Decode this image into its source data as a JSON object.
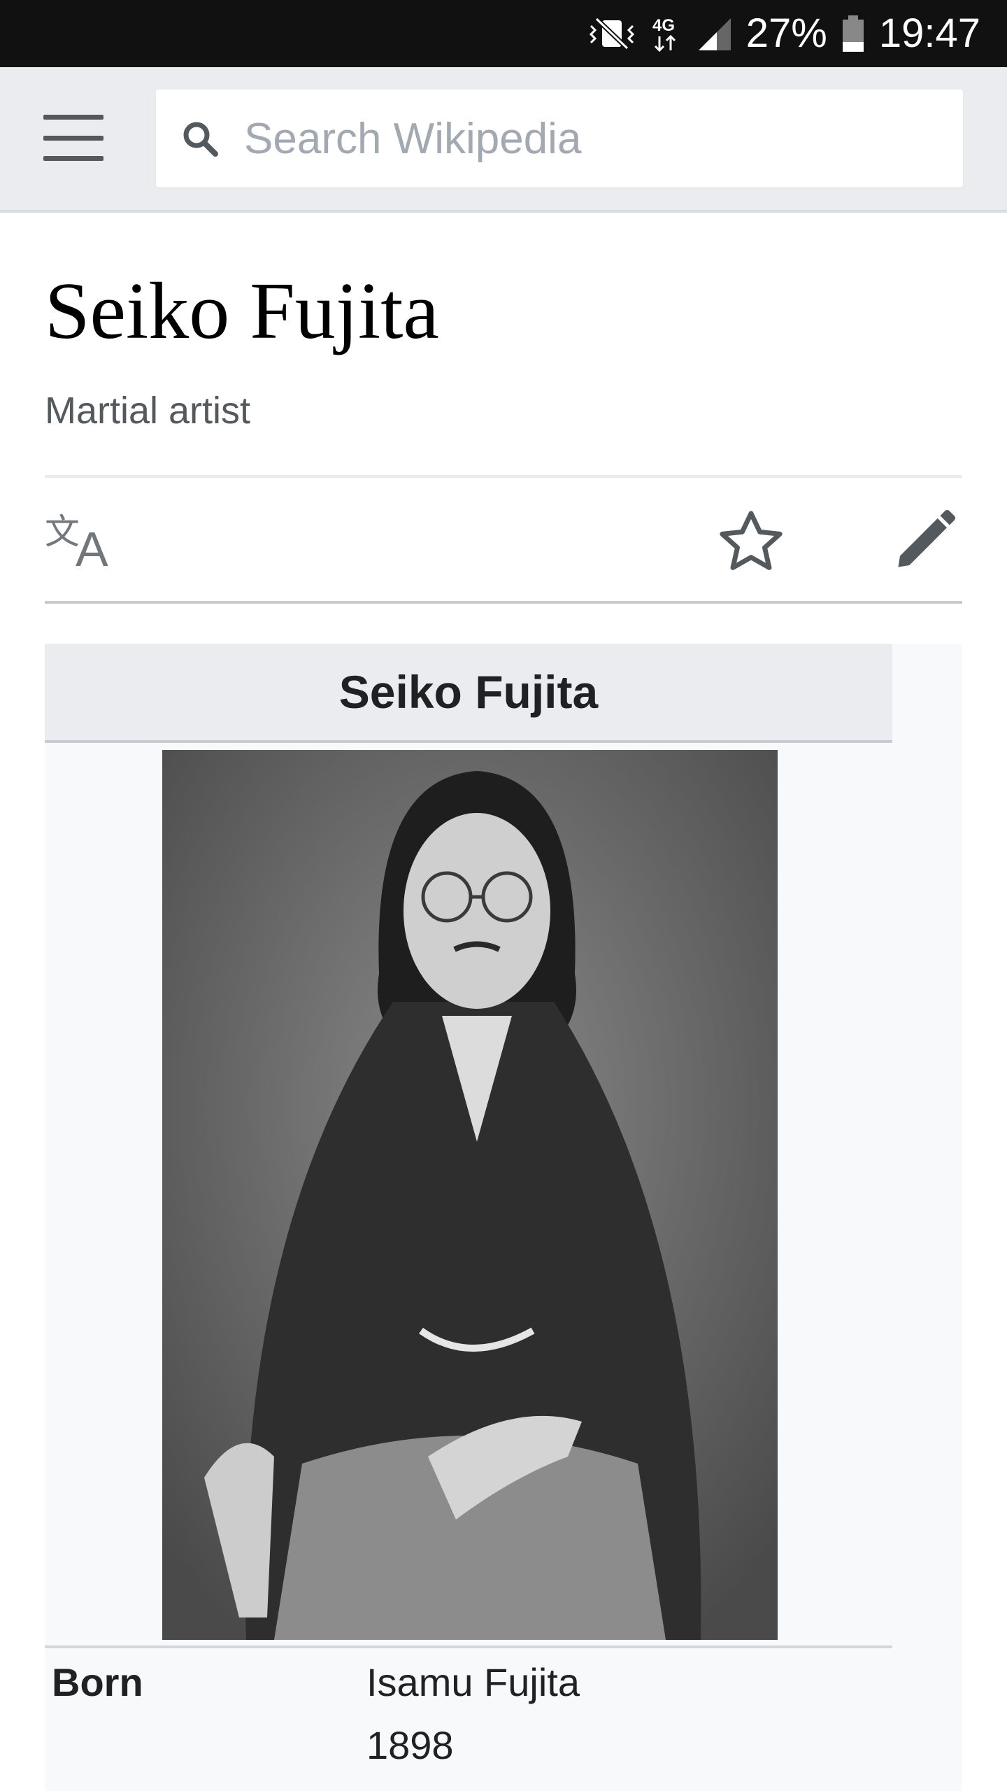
{
  "status_bar": {
    "battery": "27%",
    "time": "19:47",
    "network": "4G",
    "icons": [
      "vibrate-mute-icon",
      "network-4g-icon",
      "signal-icon",
      "battery-icon"
    ]
  },
  "header": {
    "search_placeholder": "Search Wikipedia",
    "icons": [
      "menu-icon",
      "search-icon"
    ],
    "background": "#eaecf0"
  },
  "article": {
    "title": "Seiko Fujita",
    "subtitle": "Martial artist",
    "actions": [
      "language-icon",
      "star-icon",
      "edit-pencil-icon"
    ]
  },
  "infobox": {
    "title": "Seiko Fujita",
    "portrait": "black-and-white-portrait",
    "rows": [
      {
        "label": "Born",
        "values": [
          "Isamu Fujita",
          "1898"
        ]
      }
    ]
  }
}
